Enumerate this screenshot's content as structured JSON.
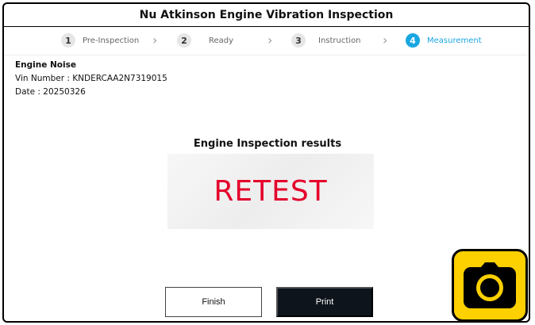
{
  "header": {
    "title": "Nu Atkinson Engine Vibration Inspection"
  },
  "steps": [
    {
      "num": "1",
      "label": "Pre-Inspection",
      "active": false
    },
    {
      "num": "2",
      "label": "Ready",
      "active": false
    },
    {
      "num": "3",
      "label": "Instruction",
      "active": false
    },
    {
      "num": "4",
      "label": "Measurement",
      "active": true
    }
  ],
  "info": {
    "heading": "Engine Noise",
    "vin": "Vin Number : KNDERCAA2N7319015",
    "date": "Date : 20250326"
  },
  "result": {
    "title": "Engine Inspection results",
    "value": "RETEST"
  },
  "buttons": {
    "finish": "Finish",
    "print": "Print"
  },
  "icons": {
    "step_separator": "chevron-right-icon",
    "camera": "camera-icon"
  },
  "colors": {
    "accent": "#1aa6e2",
    "result": "#e4002b",
    "print_bg": "#0d141c",
    "camera_bg": "#fdd000"
  }
}
